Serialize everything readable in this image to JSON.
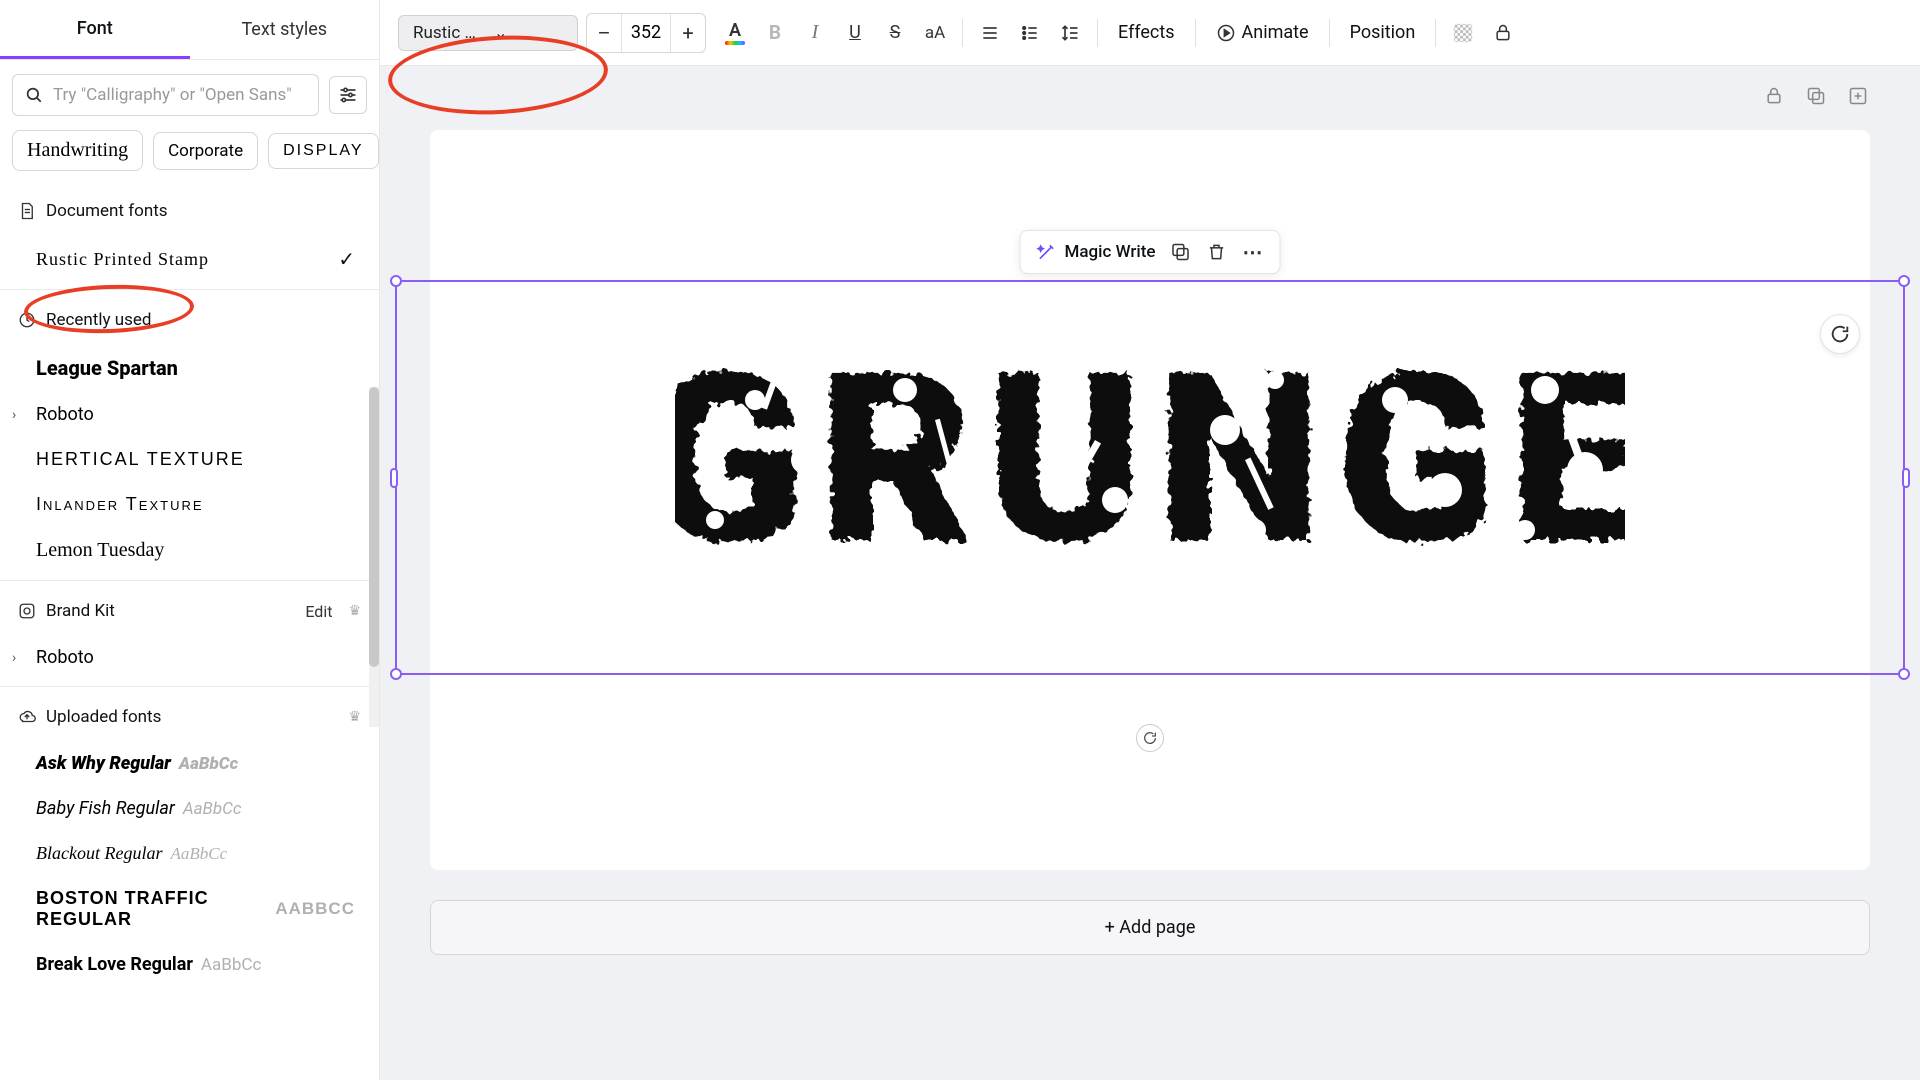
{
  "tabs": {
    "font": "Font",
    "textStyles": "Text styles"
  },
  "search": {
    "placeholder": "Try \"Calligraphy\" or \"Open Sans\""
  },
  "chips": {
    "handwriting": "Handwriting",
    "corporate": "Corporate",
    "display": "DISPLAY"
  },
  "sections": {
    "documentFonts": "Document fonts",
    "recently": "Recently used",
    "brandKit": "Brand Kit",
    "edit": "Edit",
    "uploaded": "Uploaded fonts"
  },
  "fonts": {
    "rustic": "Rustic Printed Stamp",
    "spartan": "League Spartan",
    "roboto": "Roboto",
    "hertical": "HERTICAL TEXTURE",
    "inlander": "Inlander Texture",
    "lemon": "Lemon Tuesday",
    "askwhy": "Ask Why Regular",
    "baby": "Baby Fish Regular",
    "blackout": "Blackout Regular",
    "boston": "BOSTON TRAFFIC REGULAR",
    "break": "Break Love Regular",
    "sample": "AaBbCc",
    "sampleUpper": "AABBCC"
  },
  "toolbar": {
    "fontName": "Rustic Printed St...",
    "size": "352",
    "effects": "Effects",
    "animate": "Animate",
    "position": "Position"
  },
  "canvas": {
    "magic": "Magic Write",
    "text": "GRUNGE",
    "addPage": "+ Add page"
  },
  "glyphs": {
    "minus": "–",
    "plus": "+",
    "bold": "B",
    "italic": "I",
    "check": "✓",
    "chevronDown": "⌄",
    "chevronRight": "›",
    "expand": "›",
    "more": "⋯"
  }
}
